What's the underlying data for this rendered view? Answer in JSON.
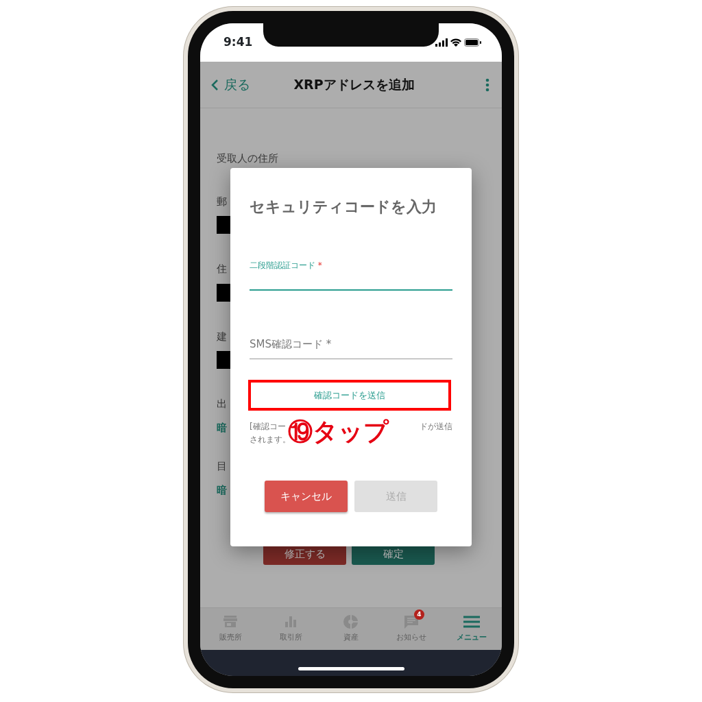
{
  "status_bar": {
    "time": "9:41"
  },
  "header": {
    "back": "戻る",
    "title": "XRPアドレスを追加"
  },
  "background": {
    "section_title": "受取人の住所",
    "fields": [
      {
        "label": "郵",
        "redacted": true
      },
      {
        "label": "住",
        "redacted": true
      },
      {
        "label": "建",
        "redacted": true
      }
    ],
    "rows": [
      {
        "label": "出",
        "value": "暗"
      },
      {
        "label": "目",
        "value": "暗"
      }
    ],
    "buttons": [
      {
        "label": "修正する",
        "kind": "danger"
      },
      {
        "label": "確定",
        "kind": "primary"
      }
    ]
  },
  "dialog": {
    "title": "セキュリティコードを入力",
    "fields": [
      {
        "label": "二段階認証コード",
        "required_mark": "*",
        "focused": true
      },
      {
        "label": "SMS確認コード",
        "required_mark": "*",
        "focused": false
      }
    ],
    "send_code": "確認コードを送信",
    "helper": [
      "[確認コー",
      "ドが送信",
      "されます。"
    ],
    "buttons": [
      {
        "label": "キャンセル",
        "kind": "danger",
        "disabled": false
      },
      {
        "label": "送信",
        "kind": "primary",
        "disabled": true
      }
    ]
  },
  "annotation": {
    "text": "⑲タップ"
  },
  "tabs": [
    {
      "label": "販売所",
      "selected": false
    },
    {
      "label": "取引所",
      "selected": false
    },
    {
      "label": "資産",
      "selected": false
    },
    {
      "label": "お知らせ",
      "selected": false,
      "badge": "4"
    },
    {
      "label": "メニュー",
      "selected": true
    }
  ]
}
